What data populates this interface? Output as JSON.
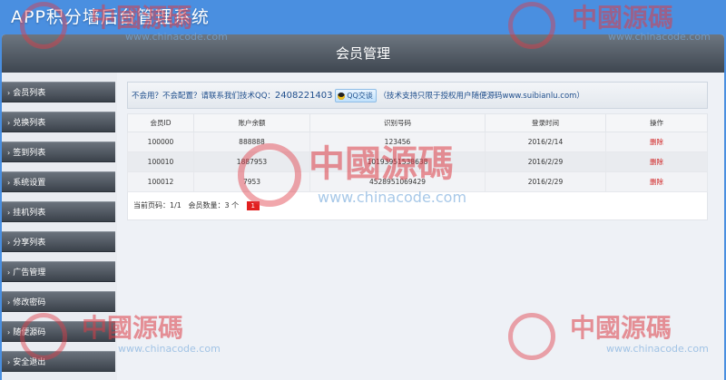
{
  "app_title": "APP积分墙后台管理系统",
  "header": {
    "title": "会员管理"
  },
  "sidebar": {
    "items": [
      {
        "label": "会员列表"
      },
      {
        "label": "兑换列表"
      },
      {
        "label": "签到列表"
      },
      {
        "label": "系统设置"
      },
      {
        "label": "挂机列表"
      },
      {
        "label": "分享列表"
      },
      {
        "label": "广告管理"
      },
      {
        "label": "修改密码"
      },
      {
        "label": "随便源码"
      },
      {
        "label": "安全退出"
      }
    ]
  },
  "notice": {
    "text": "不会用？不会配置？请联系我们技术QQ：",
    "qq_number": "2408221403",
    "qq_button": "QQ交谈",
    "suffix": "（技术支持只限于授权用户随便源码www.suibianlu.com）"
  },
  "table": {
    "headers": [
      "会员ID",
      "账户余额",
      "识别号码",
      "登录时间",
      "操作"
    ],
    "rows": [
      [
        "100000",
        "888888",
        "123456",
        "2016/2/14",
        "删除"
      ],
      [
        "100010",
        "1887953",
        "10193951538638",
        "2016/2/29",
        "删除"
      ],
      [
        "100012",
        "7953",
        "4528951069429",
        "2016/2/29",
        "删除"
      ]
    ]
  },
  "pager": {
    "current": "当前页码：1/1",
    "count": "会员数量：3 个",
    "page": "1"
  },
  "watermark": {
    "brand": "中國源碼",
    "url": "www.chinacode.com"
  },
  "colors": {
    "background": "#4a8fe0",
    "header": "#4a525c",
    "accent": "#e22020"
  }
}
